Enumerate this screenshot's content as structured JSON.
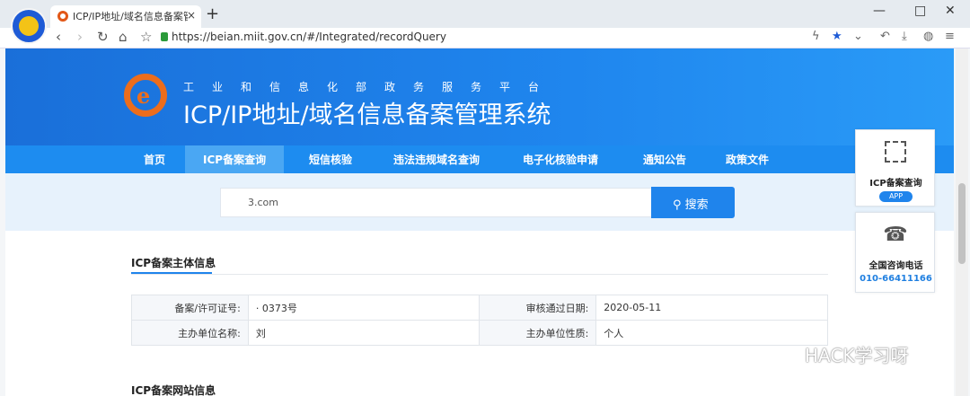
{
  "browser": {
    "tab_title": "ICP/IP地址/域名信息备案管理系统",
    "tab_close": "×",
    "new_tab": "+",
    "url": "https://beian.miit.gov.cn/#/Integrated/recordQuery",
    "window_controls": [
      "—",
      "□",
      "✕"
    ]
  },
  "header": {
    "subtitle": "工业和信息化部政务服务平台",
    "title": "ICP/IP地址/域名信息备案管理系统"
  },
  "menu": {
    "items": [
      "首页",
      "ICP备案查询",
      "短信核验",
      "违法违规域名查询",
      "电子化核验申请",
      "通知公告",
      "政策文件"
    ],
    "active_index": 1
  },
  "search": {
    "value": "3.com",
    "button_label": "搜索"
  },
  "section": {
    "title": "ICP备案主体信息",
    "next_title": "ICP备案网站信息"
  },
  "info_table": {
    "rows": [
      {
        "label1": "备案/许可证号:",
        "value1": "· 0373号",
        "label2": "审核通过日期:",
        "value2": "2020-05-11"
      },
      {
        "label1": "主办单位名称:",
        "value1": "刘",
        "label2": "主办单位性质:",
        "value2": "个人"
      }
    ]
  },
  "side": {
    "card1_title": "ICP备案查询",
    "card1_badge": "APP",
    "card2_title": "全国咨询电话",
    "card2_phone": "010-66411166"
  },
  "watermark": "HACK学习呀",
  "colors": {
    "header_blue": "#1a6fd9",
    "menu_blue": "#1d8cf0",
    "accent": "#1f84ec",
    "emblem_orange": "#ec6d1c"
  }
}
